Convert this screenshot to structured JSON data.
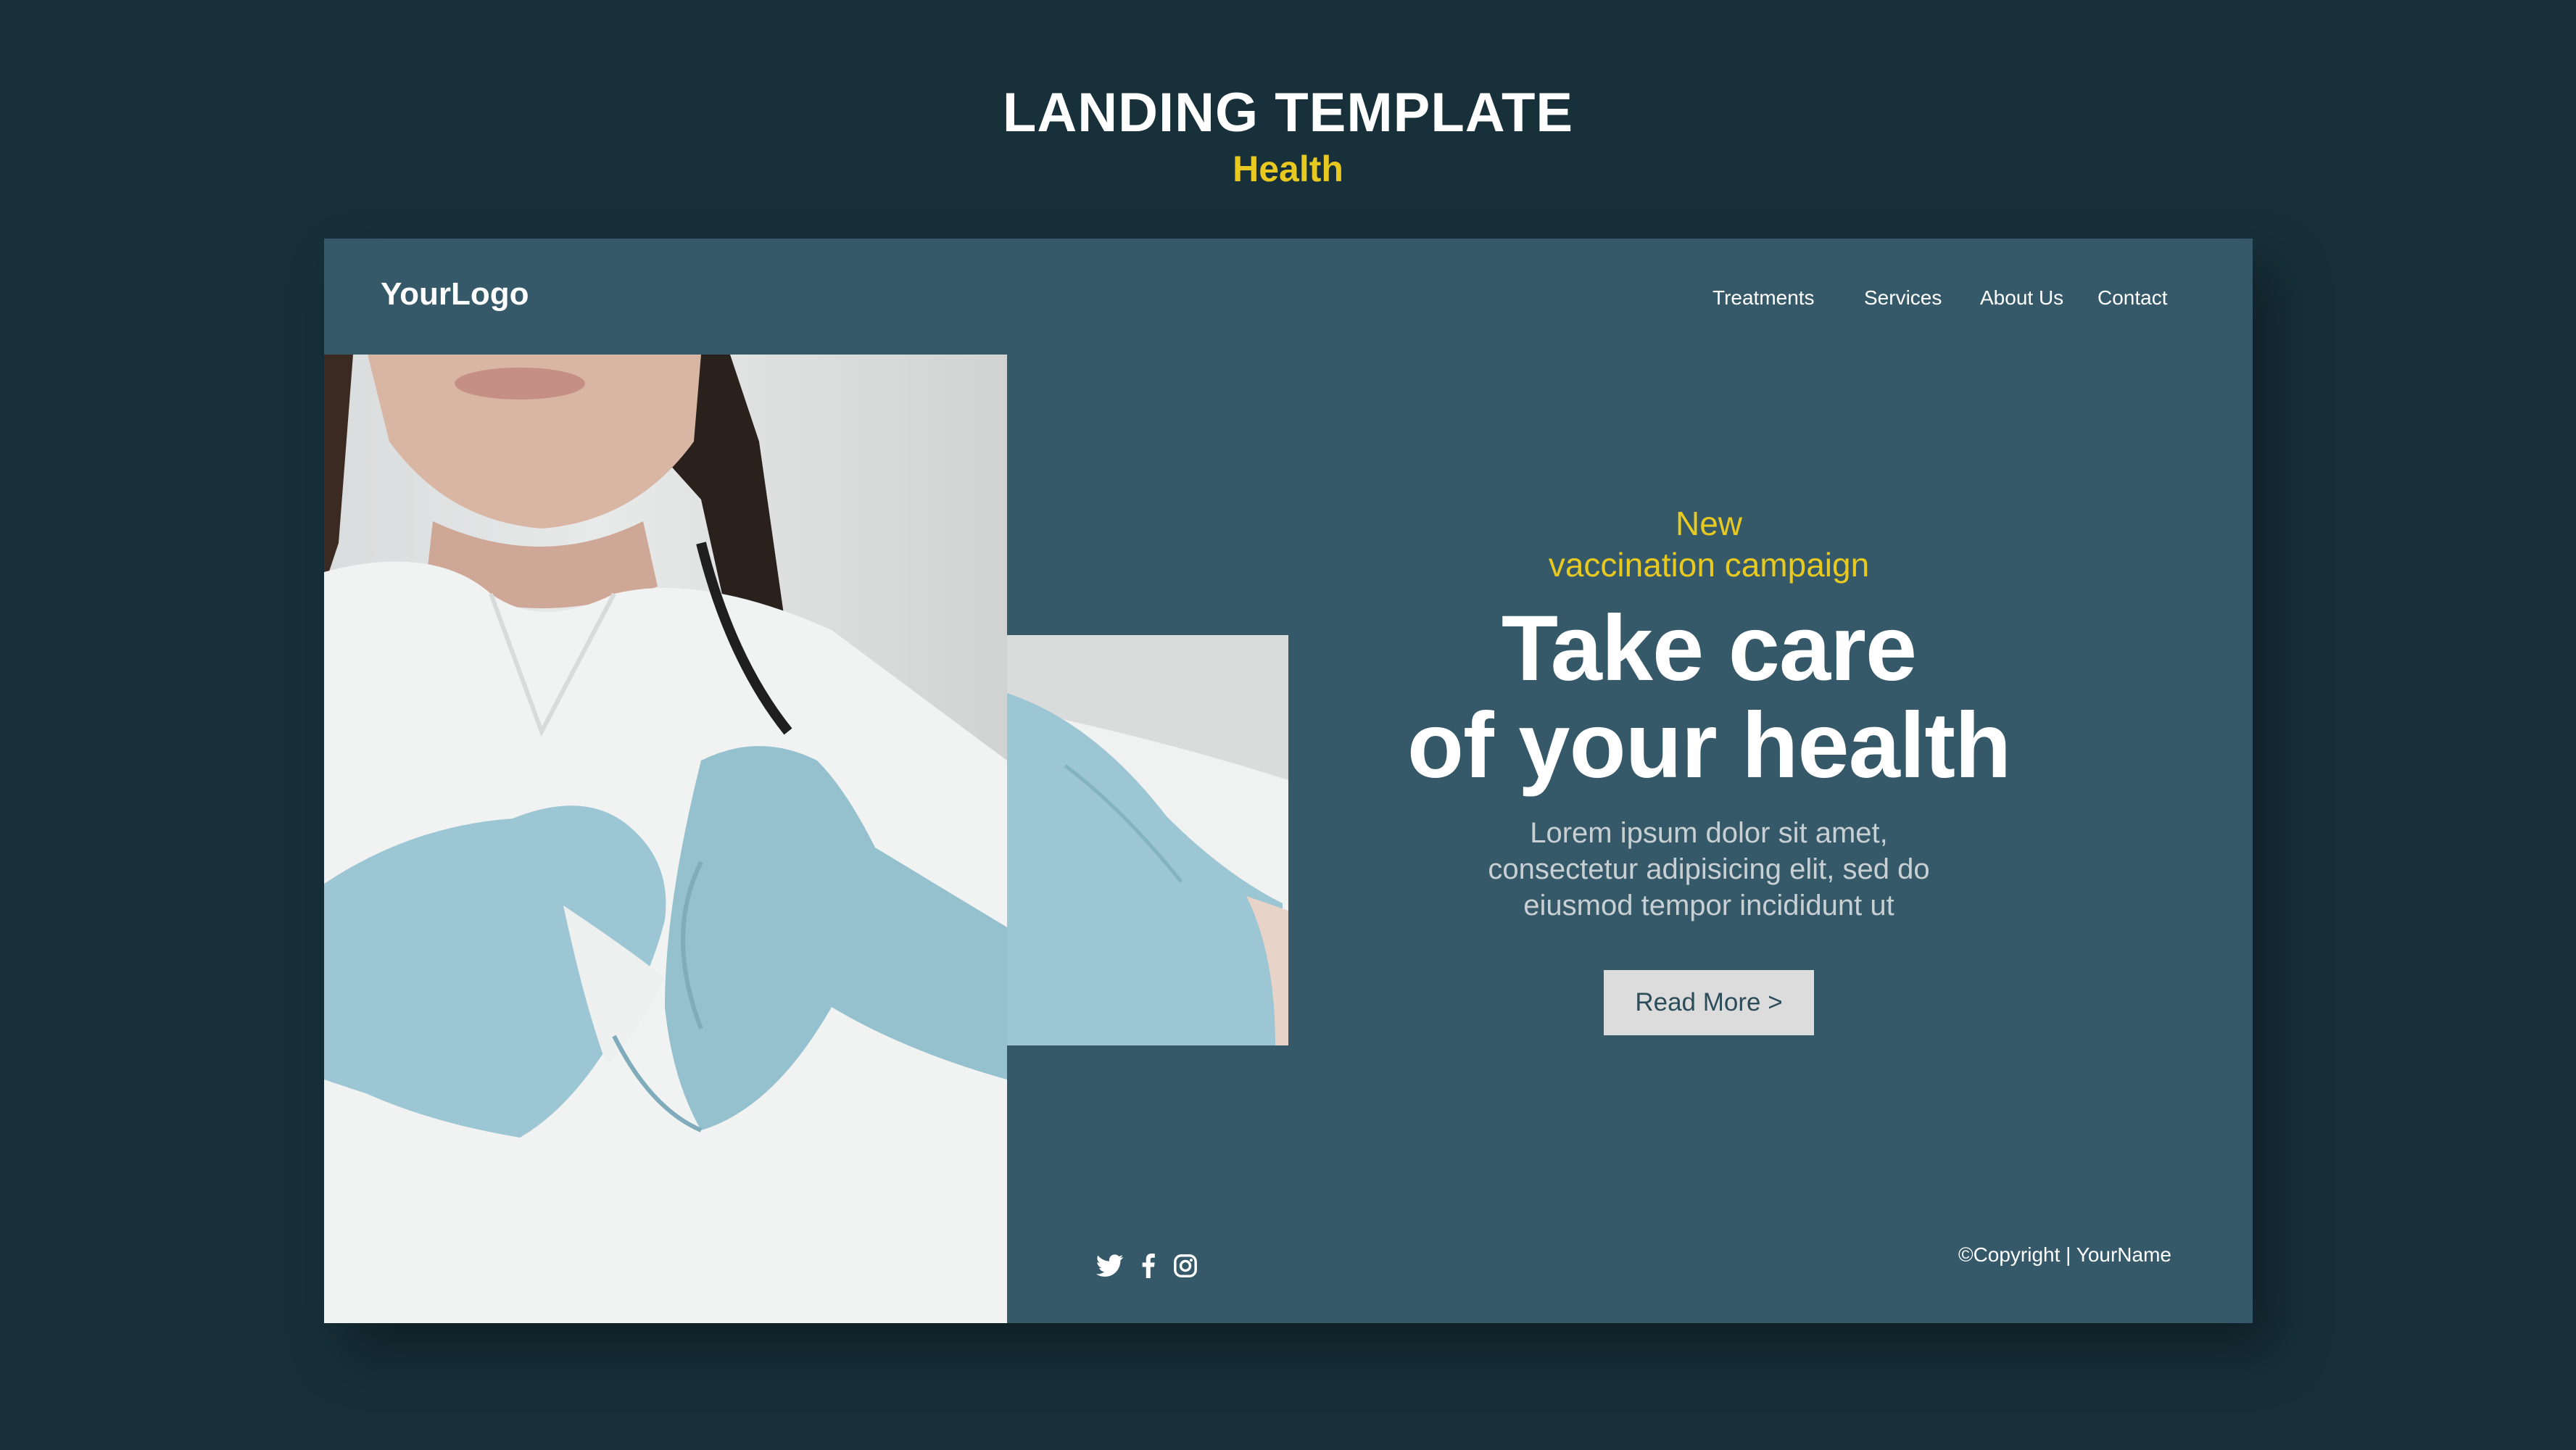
{
  "page_header": {
    "title": "LANDING TEMPLATE",
    "subtitle": "Health"
  },
  "navbar": {
    "logo": "YourLogo",
    "items": [
      "Treatments",
      "Services",
      "About Us",
      "Contact"
    ]
  },
  "hero": {
    "tag_line_1": "New",
    "tag_line_2": "vaccination campaign",
    "headline_1": "Take care",
    "headline_2": "of your health",
    "body_1": "Lorem ipsum dolor sit amet,",
    "body_2": "consectetur adipisicing elit, sed do",
    "body_3": "eiusmod tempor incididunt ut",
    "cta_label": "Read More >"
  },
  "footer": {
    "social_icons": [
      "twitter-icon",
      "facebook-icon",
      "instagram-icon"
    ],
    "copyright": "©Copyright | YourName"
  },
  "colors": {
    "page_background": "#17303a",
    "card_background": "#355969",
    "accent_yellow": "#e8c920",
    "button_background": "#dcdcdc"
  },
  "images": {
    "photo": "doctor-heart-hands-gloves"
  }
}
